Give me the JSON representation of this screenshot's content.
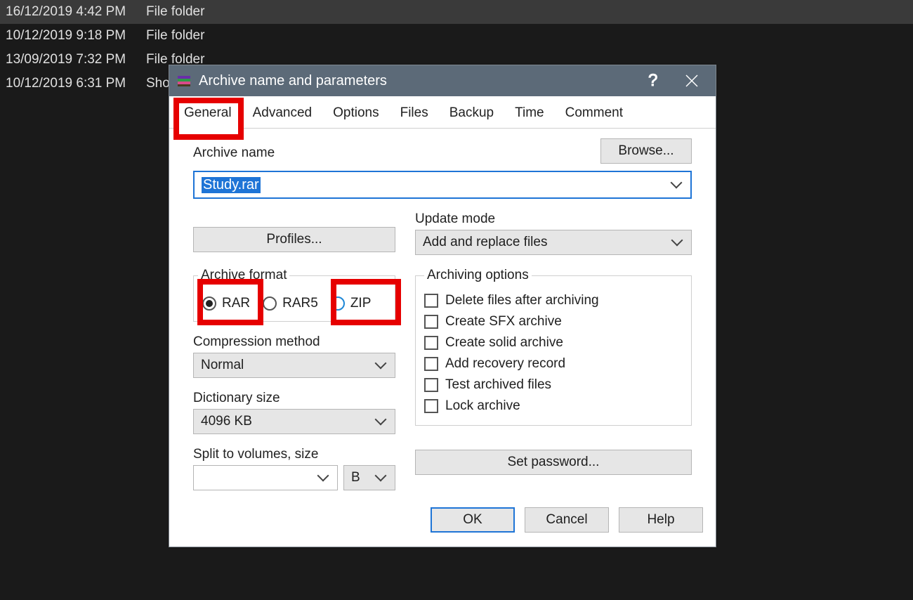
{
  "explorer": {
    "rows": [
      {
        "date": "16/12/2019 4:42 PM",
        "type": "File folder",
        "selected": true
      },
      {
        "date": "10/12/2019 9:18 PM",
        "type": "File folder",
        "selected": false
      },
      {
        "date": "13/09/2019 7:32 PM",
        "type": "File folder",
        "selected": false
      },
      {
        "date": "10/12/2019 6:31 PM",
        "type": "Sho",
        "selected": false
      }
    ]
  },
  "dialog": {
    "title": "Archive name and parameters",
    "tabs": [
      "General",
      "Advanced",
      "Options",
      "Files",
      "Backup",
      "Time",
      "Comment"
    ],
    "active_tab": "General",
    "archive_name_label": "Archive name",
    "archive_name_value": "Study.rar",
    "browse_label": "Browse...",
    "profiles_label": "Profiles...",
    "update_mode_label": "Update mode",
    "update_mode_value": "Add and replace files",
    "archive_format_label": "Archive format",
    "formats": [
      "RAR",
      "RAR5",
      "ZIP"
    ],
    "format_selected": "RAR",
    "compression_method_label": "Compression method",
    "compression_method_value": "Normal",
    "dictionary_size_label": "Dictionary size",
    "dictionary_size_value": "4096 KB",
    "split_label": "Split to volumes, size",
    "split_value": "",
    "split_unit": "B",
    "archiving_options_label": "Archiving options",
    "options": [
      "Delete files after archiving",
      "Create SFX archive",
      "Create solid archive",
      "Add recovery record",
      "Test archived files",
      "Lock archive"
    ],
    "set_password_label": "Set password...",
    "buttons": {
      "ok": "OK",
      "cancel": "Cancel",
      "help": "Help"
    }
  }
}
